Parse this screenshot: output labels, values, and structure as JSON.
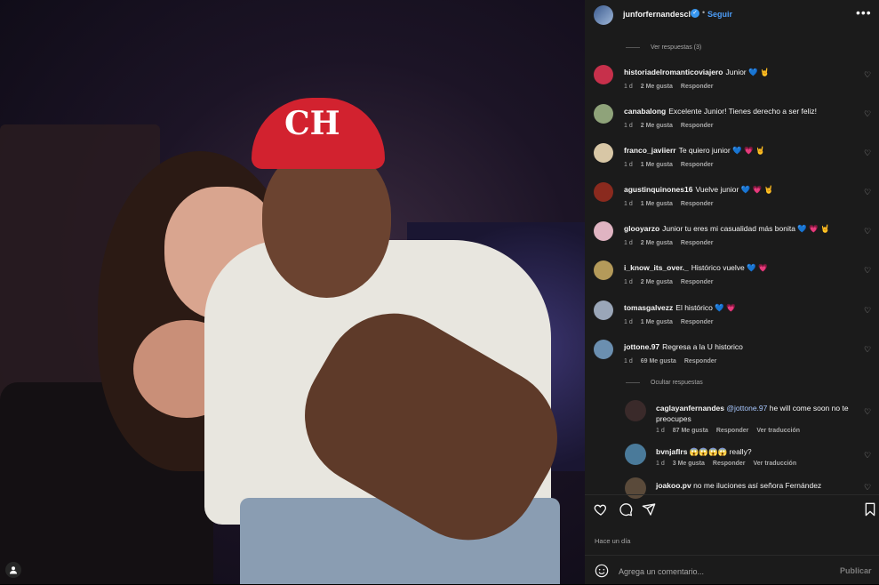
{
  "post": {
    "author": "junforfernandescl",
    "follow_label": "Seguir",
    "time_ago": "Hace un día",
    "comment_placeholder": "Agrega un comentario...",
    "publish_label": "Publicar",
    "image_cap_text": "CH"
  },
  "threads": {
    "view_replies": "Ver respuestas (3)",
    "hide_replies": "Ocultar respuestas"
  },
  "comments": [
    {
      "user": "historiadelromanticoviajero",
      "text": "Junior 💙 🤘",
      "time": "1 d",
      "likes": "2 Me gusta",
      "reply": "Responder",
      "avatar_color": "#c7304b"
    },
    {
      "user": "canabalong",
      "text": "Excelente Junior! Tienes derecho a ser feliz!",
      "time": "1 d",
      "likes": "2 Me gusta",
      "reply": "Responder",
      "avatar_color": "#8fa37a"
    },
    {
      "user": "franco_javiierr",
      "text": "Te quiero junior 💙 💗 🤘",
      "time": "1 d",
      "likes": "1 Me gusta",
      "reply": "Responder",
      "avatar_color": "#d8c7a6"
    },
    {
      "user": "agustinquinones16",
      "text": "Vuelve junior 💙 💗 🤘",
      "time": "1 d",
      "likes": "1 Me gusta",
      "reply": "Responder",
      "avatar_color": "#8a2a1e"
    },
    {
      "user": "glooyarzo",
      "text": "Junior tu eres mi casualidad más bonita 💙 💗 🤘",
      "time": "1 d",
      "likes": "2 Me gusta",
      "reply": "Responder",
      "avatar_color": "#e0b4c2"
    },
    {
      "user": "i_know_its_over._",
      "text": "Histórico vuelve 💙 💗",
      "time": "1 d",
      "likes": "2 Me gusta",
      "reply": "Responder",
      "avatar_color": "#b49a5a"
    },
    {
      "user": "tomasgalvezz",
      "text": "El histórico 💙 💗",
      "time": "1 d",
      "likes": "1 Me gusta",
      "reply": "Responder",
      "avatar_color": "#9aa6b8"
    },
    {
      "user": "jottone.97",
      "text": "Regresa a la U historico",
      "time": "1 d",
      "likes": "69 Me gusta",
      "reply": "Responder",
      "avatar_color": "#6b8fb0"
    }
  ],
  "replies": [
    {
      "user": "caglayanfernandes",
      "mention": "@jottone.97",
      "text": " he will come soon no te preocupes",
      "time": "1 d",
      "likes": "87 Me gusta",
      "reply": "Responder",
      "translate": "Ver traducción",
      "avatar_color": "#3a2a2a"
    },
    {
      "user": "bvnjaflrs",
      "text": "😱😱😱😱 really?",
      "time": "1 d",
      "likes": "3 Me gusta",
      "reply": "Responder",
      "translate": "Ver traducción",
      "avatar_color": "#4a7a9a"
    },
    {
      "user": "joakoo.pv",
      "text": "no me iluciones así señora Fernández",
      "avatar_color": "#5a4a3a"
    }
  ],
  "colors": {
    "accent": "#4c9df8",
    "panel": "#1b1b1b",
    "muted": "#a8a8a8"
  },
  "icons": [
    "more-icon",
    "heart-icon",
    "comment-icon",
    "share-icon",
    "bookmark-icon",
    "emoji-icon",
    "verified-icon"
  ]
}
